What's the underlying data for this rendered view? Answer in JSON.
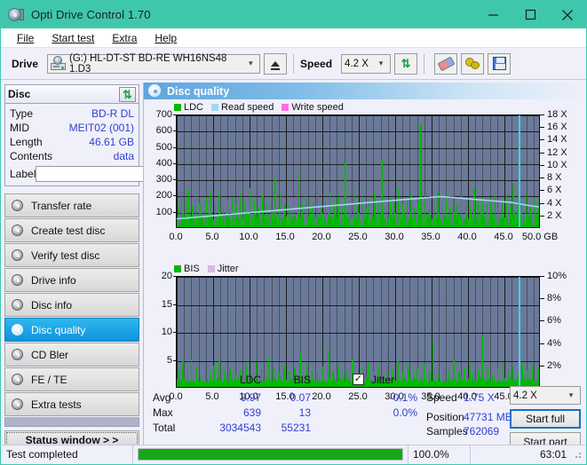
{
  "window": {
    "title": "Opti Drive Control 1.70",
    "icon": "disc-icon",
    "minimize": "minimize-icon",
    "maximize": "maximize-icon",
    "close": "close-icon"
  },
  "menu": [
    {
      "label": "File",
      "accel": "F"
    },
    {
      "label": "Start test",
      "accel": "S"
    },
    {
      "label": "Extra",
      "accel": "x"
    },
    {
      "label": "Help",
      "accel": "H"
    }
  ],
  "toolbar": {
    "drive_label": "Drive",
    "drive_value": "(G:)  HL-DT-ST BD-RE  WH16NS48 1.D3",
    "eject_label": "eject-button",
    "speed_label": "Speed",
    "speed_value": "4.2 X",
    "refresh_label": "refresh-button",
    "eraser_label": "erase-button",
    "bulb_label": "tools-button",
    "save_label": "save-button"
  },
  "disc": {
    "header": "Disc",
    "refresh_icon": "refresh-icon",
    "rows": [
      {
        "key": "Type",
        "value": "BD-R DL"
      },
      {
        "key": "MID",
        "value": "MEIT02 (001)"
      },
      {
        "key": "Length",
        "value": "46.61 GB"
      },
      {
        "key": "Contents",
        "value": "data"
      }
    ],
    "label_key": "Label",
    "label_value": "",
    "label_placeholder": ""
  },
  "sidebar": {
    "items": [
      {
        "label": "Transfer rate",
        "selected": false
      },
      {
        "label": "Create test disc",
        "selected": false
      },
      {
        "label": "Verify test disc",
        "selected": false
      },
      {
        "label": "Drive info",
        "selected": false
      },
      {
        "label": "Disc info",
        "selected": false
      },
      {
        "label": "Disc quality",
        "selected": true
      },
      {
        "label": "CD Bler",
        "selected": false
      },
      {
        "label": "FE / TE",
        "selected": false
      },
      {
        "label": "Extra tests",
        "selected": false
      }
    ],
    "status_window": "Status window > >"
  },
  "panel": {
    "title": "Disc quality",
    "icon": "disc-quality-icon"
  },
  "stats": {
    "col_headers": [
      "LDC",
      "BIS"
    ],
    "jitter_label": "Jitter",
    "jitter_checked": true,
    "rows": [
      {
        "key": "Avg",
        "ldc": "3.97",
        "bis": "0.07",
        "jitter": "-0.1%"
      },
      {
        "key": "Max",
        "ldc": "639",
        "bis": "13",
        "jitter": "0.0%"
      },
      {
        "key": "Total",
        "ldc": "3034543",
        "bis": "55231",
        "jitter": ""
      }
    ]
  },
  "readout": {
    "speed_key": "Speed",
    "speed_value": "1.75 X",
    "position_key": "Position",
    "position_value": "47731 MB",
    "samples_key": "Samples",
    "samples_value": "762069",
    "speed_select": "4.2 X",
    "start_full": "Start full",
    "start_part": "Start part"
  },
  "statusbar": {
    "message": "Test completed",
    "percent_label": "100.0%",
    "percent_value": 100,
    "time": "63:01"
  },
  "chart_data": [
    {
      "type": "line",
      "name": "ldc-chart",
      "title": "",
      "legend": [
        {
          "label": "LDC",
          "color": "#00b800"
        },
        {
          "label": "Read speed",
          "color": "#9fd8f5"
        },
        {
          "label": "Write speed",
          "color": "#ff6ee0"
        }
      ],
      "legend_position": "top-left",
      "xlabel": "GB",
      "ylabel": "LDC",
      "y2label": "X",
      "xlim": [
        0,
        50
      ],
      "ylim": [
        0,
        700
      ],
      "y2lim": [
        0,
        18
      ],
      "xticks": [
        "0.0",
        "5.0",
        "10.0",
        "15.0",
        "20.0",
        "25.0",
        "30.0",
        "35.0",
        "40.0",
        "45.0",
        "50.0 GB"
      ],
      "yticks": [
        100,
        200,
        300,
        400,
        500,
        600,
        700
      ],
      "y2ticks": [
        "2 X",
        "4 X",
        "6 X",
        "8 X",
        "10 X",
        "12 X",
        "14 X",
        "16 X",
        "18 X"
      ],
      "grid": true,
      "plot_bg": "#6b7a99",
      "series": [
        {
          "name": "LDC",
          "color": "#00b800",
          "type": "bar",
          "values": [
            60,
            145,
            75,
            220,
            90,
            55,
            170,
            60,
            240,
            80,
            50,
            130,
            65,
            195,
            70,
            55,
            150,
            85,
            60,
            110,
            70,
            180,
            55,
            90,
            230,
            65,
            50,
            140,
            75,
            60,
            200,
            85,
            55,
            120,
            70,
            95,
            165,
            60,
            50,
            185,
            75,
            60,
            135,
            90,
            55,
            210,
            65,
            50,
            155,
            80,
            60,
            100,
            240,
            70,
            55,
            175,
            85,
            60,
            125,
            95,
            50,
            190,
            70,
            55,
            145,
            80,
            60,
            165,
            90,
            50,
            300,
            75,
            60,
            115,
            205,
            55,
            85,
            150,
            65,
            50,
            130,
            95,
            60,
            180,
            70,
            55,
            340,
            85,
            60,
            140,
            75,
            50,
            195,
            90,
            65,
            120,
            55,
            160,
            80,
            60,
            250,
            70,
            55,
            135,
            90,
            60,
            175,
            50,
            85,
            215,
            65,
            55,
            145,
            95,
            60,
            185,
            75,
            50,
            125,
            80,
            400,
            65,
            55,
            155,
            90,
            60,
            230,
            70,
            50,
            140,
            85,
            55,
            195,
            95,
            60,
            115,
            75,
            170,
            50,
            90,
            60,
            205,
            65,
            55,
            150,
            80,
            420,
            95,
            60,
            130,
            70,
            50,
            185,
            85,
            55,
            160,
            90,
            60,
            240,
            75,
            50,
            140,
            95,
            65,
            175,
            55,
            85,
            200,
            60,
            120,
            70,
            50,
            155,
            90,
            640,
            75,
            60,
            190,
            80,
            55,
            135,
            95,
            50,
            165,
            70,
            60,
            220,
            85,
            55,
            145,
            90,
            65,
            180,
            50,
            75,
            125,
            60,
            210,
            95,
            55,
            150,
            80,
            70,
            195,
            60,
            50,
            170,
            90,
            55,
            130,
            85,
            65,
            245,
            75,
            60,
            160,
            50,
            95,
            185,
            70,
            55,
            140,
            90,
            60,
            175,
            80,
            50,
            215,
            65,
            120,
            95,
            55,
            155,
            70,
            60,
            190,
            85,
            50,
            135,
            75,
            260,
            90,
            60,
            165,
            55,
            95,
            145,
            70,
            50,
            200,
            80,
            60,
            125,
            85,
            55,
            180,
            95,
            65,
            150,
            70
          ]
        },
        {
          "name": "Read speed",
          "color": "#9fd8f5",
          "type": "line",
          "values": [
            1.6,
            1.7,
            1.8,
            1.9,
            2.0,
            2.1,
            2.2,
            2.3,
            2.4,
            2.5,
            2.6,
            2.7,
            2.8,
            2.9,
            3.0,
            3.1,
            3.2,
            3.3,
            3.4,
            3.5,
            3.6,
            3.7,
            3.8,
            3.9,
            4.0,
            4.1,
            4.2,
            4.3,
            4.4,
            4.5,
            4.6,
            4.7,
            4.8,
            4.9,
            5.0,
            5.1,
            5.1,
            5.0,
            4.9,
            4.8,
            4.7,
            4.6,
            4.5,
            4.4,
            4.3,
            4.2,
            4.0,
            3.8,
            3.6,
            3.5
          ]
        }
      ],
      "markers": [
        {
          "type": "vline",
          "x": 47.0,
          "color": "#3fd0f0"
        }
      ]
    },
    {
      "type": "bar",
      "name": "bis-chart",
      "title": "",
      "legend": [
        {
          "label": "BIS",
          "color": "#00b800"
        },
        {
          "label": "Jitter",
          "color": "#d8b8e8"
        }
      ],
      "legend_position": "top-left",
      "xlabel": "GB",
      "ylabel": "BIS",
      "y2label": "%",
      "xlim": [
        0,
        50
      ],
      "ylim": [
        0,
        20
      ],
      "y2lim": [
        0,
        10
      ],
      "xticks": [
        "0.0",
        "5.0",
        "10.0",
        "15.0",
        "20.0",
        "25.0",
        "30.0",
        "35.0",
        "40.0",
        "45.0",
        "50.0 GB"
      ],
      "yticks": [
        5,
        10,
        15,
        20
      ],
      "y2ticks": [
        "2%",
        "4%",
        "6%",
        "8%",
        "10%"
      ],
      "grid": true,
      "plot_bg": "#6b7a99",
      "series": [
        {
          "name": "BIS",
          "color": "#00b800",
          "type": "bar",
          "values": [
            1.5,
            3.2,
            1.0,
            4.6,
            1.8,
            0.9,
            2.8,
            1.2,
            5.0,
            1.6,
            1.0,
            3.6,
            1.4,
            2.0,
            1.1,
            0.8,
            4.2,
            1.5,
            1.0,
            2.6,
            1.3,
            3.8,
            0.9,
            1.7,
            4.8,
            1.2,
            0.8,
            2.9,
            1.5,
            1.0,
            3.4,
            1.6,
            0.9,
            2.2,
            1.3,
            1.8,
            3.0,
            1.1,
            0.8,
            4.0,
            1.4,
            1.0,
            2.5,
            1.7,
            0.9,
            4.4,
            1.2,
            0.8,
            3.1,
            1.5,
            1.0,
            2.0,
            5.2,
            1.3,
            0.9,
            3.5,
            1.6,
            1.1,
            2.4,
            1.8,
            0.8,
            3.9,
            1.3,
            1.0,
            2.7,
            1.5,
            1.1,
            3.3,
            1.7,
            0.9,
            6.0,
            1.4,
            1.0,
            2.1,
            4.1,
            1.0,
            1.6,
            2.9,
            1.2,
            0.9,
            2.5,
            1.8,
            1.1,
            3.6,
            1.3,
            1.0,
            6.8,
            1.6,
            1.1,
            2.7,
            1.4,
            0.9,
            3.8,
            1.7,
            1.2,
            2.3,
            1.0,
            3.1,
            1.5,
            1.1,
            5.0,
            1.3,
            1.0,
            2.6,
            1.7,
            1.1,
            3.4,
            0.9,
            1.6,
            4.3,
            1.2,
            1.0,
            2.8,
            1.8,
            1.1,
            3.7,
            1.4,
            0.9,
            2.4,
            1.5,
            7.2,
            1.2,
            1.0,
            3.0,
            1.7,
            1.1,
            4.6,
            1.3,
            0.9,
            2.7,
            1.6,
            1.0,
            3.9,
            1.8,
            1.1,
            2.2,
            1.4,
            3.3,
            0.9,
            1.7,
            1.1,
            4.1,
            1.2,
            1.0,
            2.9,
            1.5,
            8.4,
            1.8,
            1.1,
            2.5,
            1.3,
            0.9,
            3.7,
            1.6,
            1.0,
            3.2,
            1.7,
            1.1,
            4.8,
            1.4,
            0.9,
            2.7,
            1.8,
            1.2,
            3.5,
            1.0,
            1.6,
            4.0,
            1.1,
            2.3,
            1.3,
            0.9,
            3.1,
            1.7,
            9.0,
            1.4,
            1.1,
            3.8,
            1.5,
            1.0,
            2.6,
            1.8,
            0.9,
            3.3,
            1.3,
            1.1,
            4.4,
            1.6,
            1.0,
            2.8,
            1.7,
            1.2,
            3.6,
            0.9,
            1.4,
            2.4,
            1.1,
            4.2,
            1.8,
            1.0,
            3.0,
            1.5,
            1.3,
            3.9,
            1.1,
            0.9,
            3.4,
            1.7
          ]
        }
      ],
      "markers": [
        {
          "type": "vline",
          "x": 47.0,
          "color": "#3fd0f0"
        }
      ]
    }
  ]
}
